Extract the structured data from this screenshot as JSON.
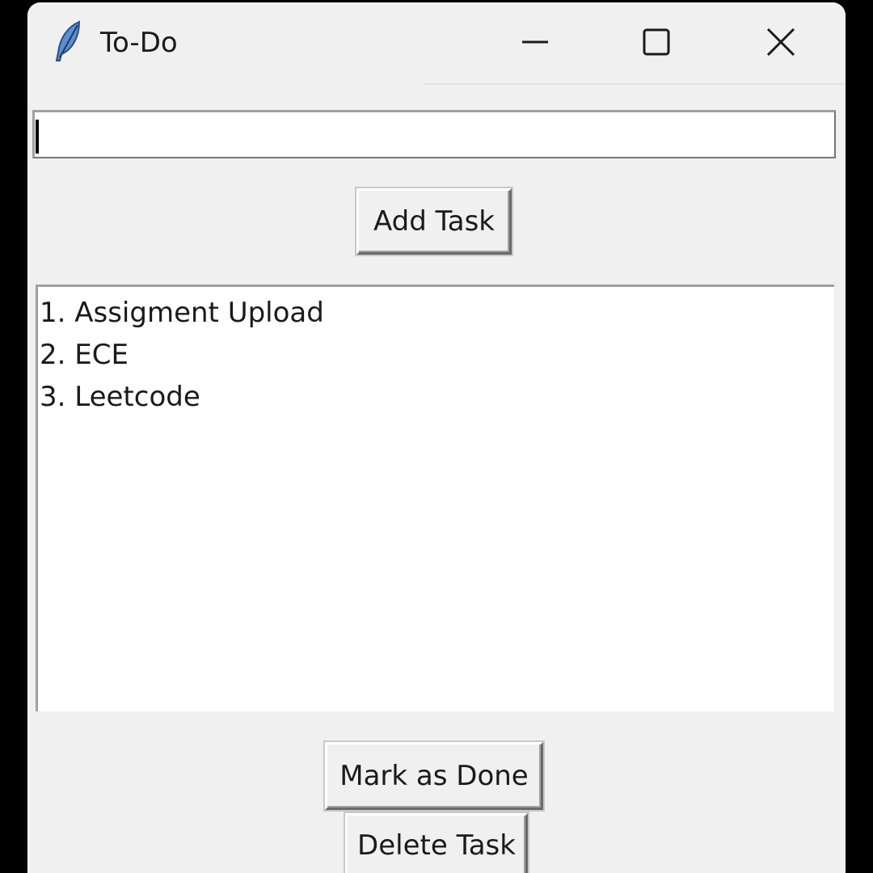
{
  "window": {
    "title": "To-Do",
    "icon": "feather-icon",
    "controls": {
      "minimize": "minimize-icon",
      "maximize": "maximize-icon",
      "close": "close-icon"
    }
  },
  "entry": {
    "value": ""
  },
  "buttons": {
    "add": "Add Task",
    "mark_done": "Mark as Done",
    "delete": "Delete Task"
  },
  "tasks": [
    "1. Assigment Upload",
    "2. ECE",
    "3. Leetcode"
  ],
  "colors": {
    "window_bg": "#f0f0f0",
    "field_bg": "#ffffff",
    "text": "#1a1a1a"
  }
}
